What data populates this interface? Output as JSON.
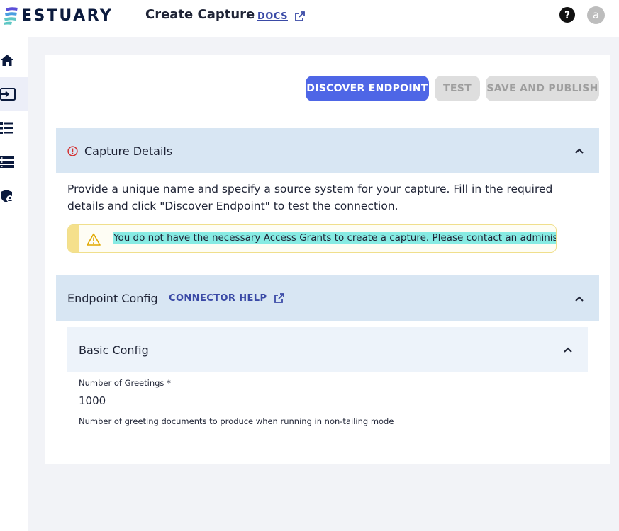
{
  "header": {
    "logo_text": "ESTUARY",
    "page_title": "Create Capture",
    "docs_label": "DOCS",
    "avatar_initial": "a"
  },
  "sidebar": {
    "items": [
      {
        "icon": "home-icon"
      },
      {
        "icon": "capture-icon",
        "active": true
      },
      {
        "icon": "collections-icon"
      },
      {
        "icon": "materializations-icon"
      },
      {
        "icon": "admin-icon"
      }
    ]
  },
  "actions": {
    "discover_label": "DISCOVER ENDPOINT",
    "test_label": "TEST",
    "save_label": "SAVE AND PUBLISH"
  },
  "capture_details": {
    "title": "Capture Details",
    "description": "Provide a unique name and specify a source system for your capture. Fill in the required details and click \"Discover Endpoint\" to test the connection.",
    "alert_text": "You do not have the necessary Access Grants to create a capture. Please contact an administrator."
  },
  "endpoint_config": {
    "title": "Endpoint Config",
    "connector_help_label": "CONNECTOR HELP",
    "basic_config_title": "Basic Config",
    "field_label": "Number of Greetings *",
    "field_value": "1000",
    "field_help": "Number of greeting documents to produce when running in non-tailing mode"
  },
  "colors": {
    "accent": "#4e66e6",
    "section_header": "#d8e6f3",
    "alert_highlight": "#87ebe3",
    "error": "#d32f2f"
  }
}
